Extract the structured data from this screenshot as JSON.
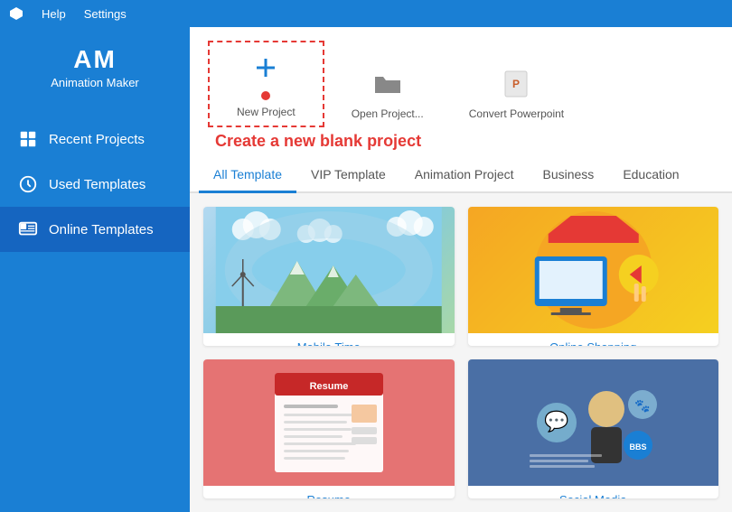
{
  "menubar": {
    "help": "Help",
    "settings": "Settings"
  },
  "sidebar": {
    "logo": "AM",
    "logo_sub": "Animation Maker",
    "items": [
      {
        "id": "recent",
        "label": "Recent Projects",
        "icon": "recent-icon"
      },
      {
        "id": "used",
        "label": "Used Templates",
        "icon": "used-icon"
      },
      {
        "id": "online",
        "label": "Online Templates",
        "icon": "online-icon"
      }
    ]
  },
  "actions": {
    "new_project": "New Project",
    "open_project": "Open Project...",
    "convert_powerpoint": "Convert Powerpoint",
    "create_hint": "Create a new blank project"
  },
  "tabs": [
    {
      "id": "all",
      "label": "All Template",
      "active": true
    },
    {
      "id": "vip",
      "label": "VIP Template"
    },
    {
      "id": "animation",
      "label": "Animation Project"
    },
    {
      "id": "business",
      "label": "Business"
    },
    {
      "id": "education",
      "label": "Education"
    }
  ],
  "templates": [
    {
      "id": "mobile-time",
      "name": "Mobile Time"
    },
    {
      "id": "online-shopping",
      "name": "Online Shopping"
    },
    {
      "id": "resume",
      "name": "Resume"
    },
    {
      "id": "social",
      "name": "Social Media"
    }
  ]
}
